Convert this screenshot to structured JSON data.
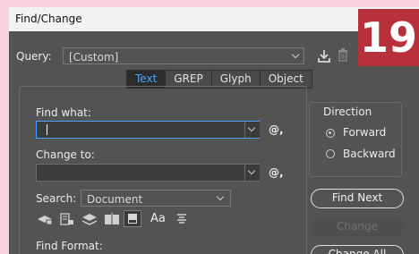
{
  "window": {
    "title": "Find/Change"
  },
  "badge": {
    "text": "19"
  },
  "query": {
    "label": "Query:",
    "value": "[Custom]"
  },
  "tabs": [
    {
      "label": "Text",
      "active": true
    },
    {
      "label": "GREP",
      "active": false
    },
    {
      "label": "Glyph",
      "active": false
    },
    {
      "label": "Object",
      "active": false
    }
  ],
  "find": {
    "label": "Find what:",
    "value": "",
    "special_char_symbol": "@,"
  },
  "change": {
    "label": "Change to:",
    "value": "",
    "special_char_symbol": "@,"
  },
  "search": {
    "label": "Search:",
    "value": "Document"
  },
  "options": {
    "icons": [
      "include-locked-layers-icon",
      "include-locked-stories-icon",
      "include-hidden-layers-icon",
      "include-master-pages-icon",
      "include-footnotes-icon",
      "case-sensitive-icon",
      "whole-word-icon"
    ],
    "case_label": "Aa"
  },
  "find_format": {
    "label": "Find Format:"
  },
  "direction": {
    "title": "Direction",
    "options": [
      {
        "label": "Forward",
        "selected": true
      },
      {
        "label": "Backward",
        "selected": false
      }
    ]
  },
  "buttons": {
    "find_next": "Find Next",
    "change": "Change",
    "change_all": "Change All"
  },
  "colors": {
    "accent": "#4aa3ff",
    "badge": "#b8313a",
    "panel": "#535353",
    "background": "#f6d3dc"
  }
}
